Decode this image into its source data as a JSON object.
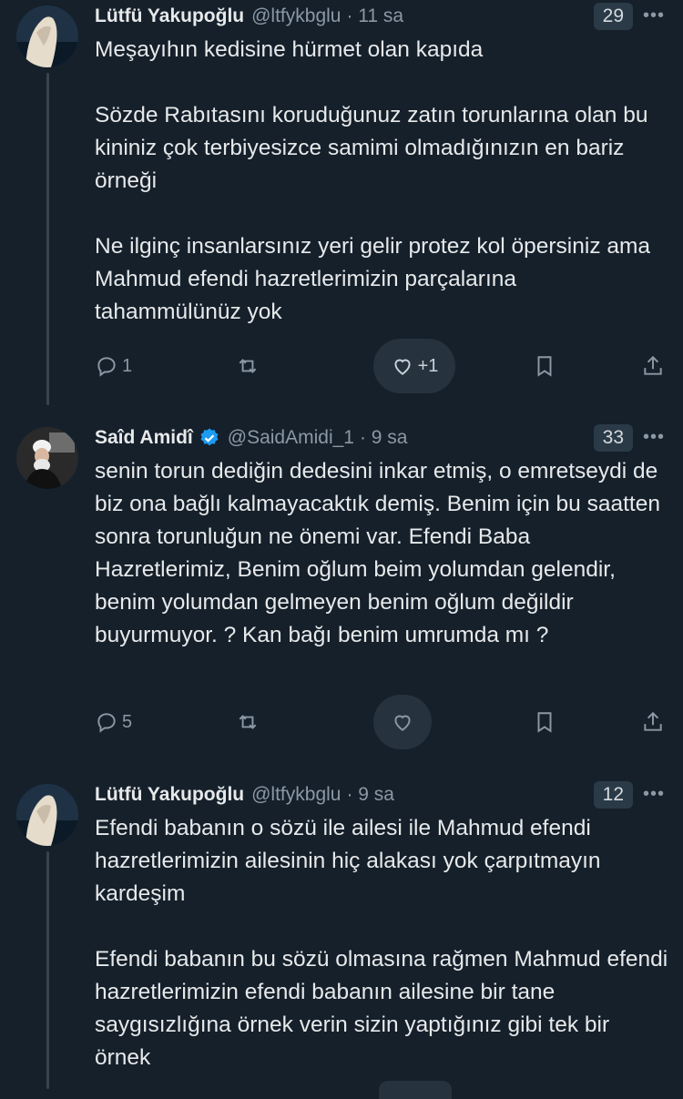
{
  "tweets": [
    {
      "name": "Lütfü Yakupoğlu",
      "handle": "@ltfykbglu",
      "time": "· 11 sa",
      "count": "29",
      "text": "Meşayıhın kedisine hürmet olan kapıda\n\nSözde Rabıtasını koruduğunuz zatın torunlarına olan bu kininiz çok terbiyesizce samimi olmadığınızın en bariz örneği\n\nNe ilginç insanlarsınız yeri gelir protez kol öpersiniz ama Mahmud efendi hazretlerimizin parçalarına tahammülünüz yok",
      "reply_count": "1",
      "like_label": "+1",
      "more": "•••"
    },
    {
      "name": "Saîd Amidî",
      "handle": "@SaidAmidi_1",
      "time": "· 9 sa",
      "count": "33",
      "verified": true,
      "text": "senin torun dediğin dedesini inkar etmiş, o emretseydi de biz ona bağlı kalmayacaktık demiş. Benim için bu saatten sonra torunluğun ne önemi var. Efendi Baba Hazretlerimiz, Benim oğlum beim yolumdan gelendir, benim yolumdan gelmeyen benim oğlum değildir buyurmuyor. ? Kan bağı benim umrumda mı ?",
      "reply_count": "5",
      "like_label": "",
      "more": "•••"
    },
    {
      "name": "Lütfü Yakupoğlu",
      "handle": "@ltfykbglu",
      "time": "· 9 sa",
      "count": "12",
      "text": "Efendi babanın o sözü ile ailesi ile Mahmud efendi hazretlerimizin ailesinin hiç alakası yok çarpıtmayın kardeşim\n\nEfendi babanın bu sözü olmasına rağmen Mahmud efendi hazretlerimizin efendi babanın ailesine bir tane saygısızlığına örnek verin sizin yaptığınız gibi tek bir örnek",
      "more": "•••"
    }
  ],
  "colors": {
    "background": "#15202b",
    "text": "#e7e9ea",
    "secondary": "#8b98a5",
    "verified": "#1d9bf0",
    "badge": "#2a3a47"
  },
  "icons": [
    "reply-icon",
    "retweet-icon",
    "heart-icon",
    "bookmark-icon",
    "share-icon",
    "verified-badge-icon",
    "more-icon"
  ]
}
